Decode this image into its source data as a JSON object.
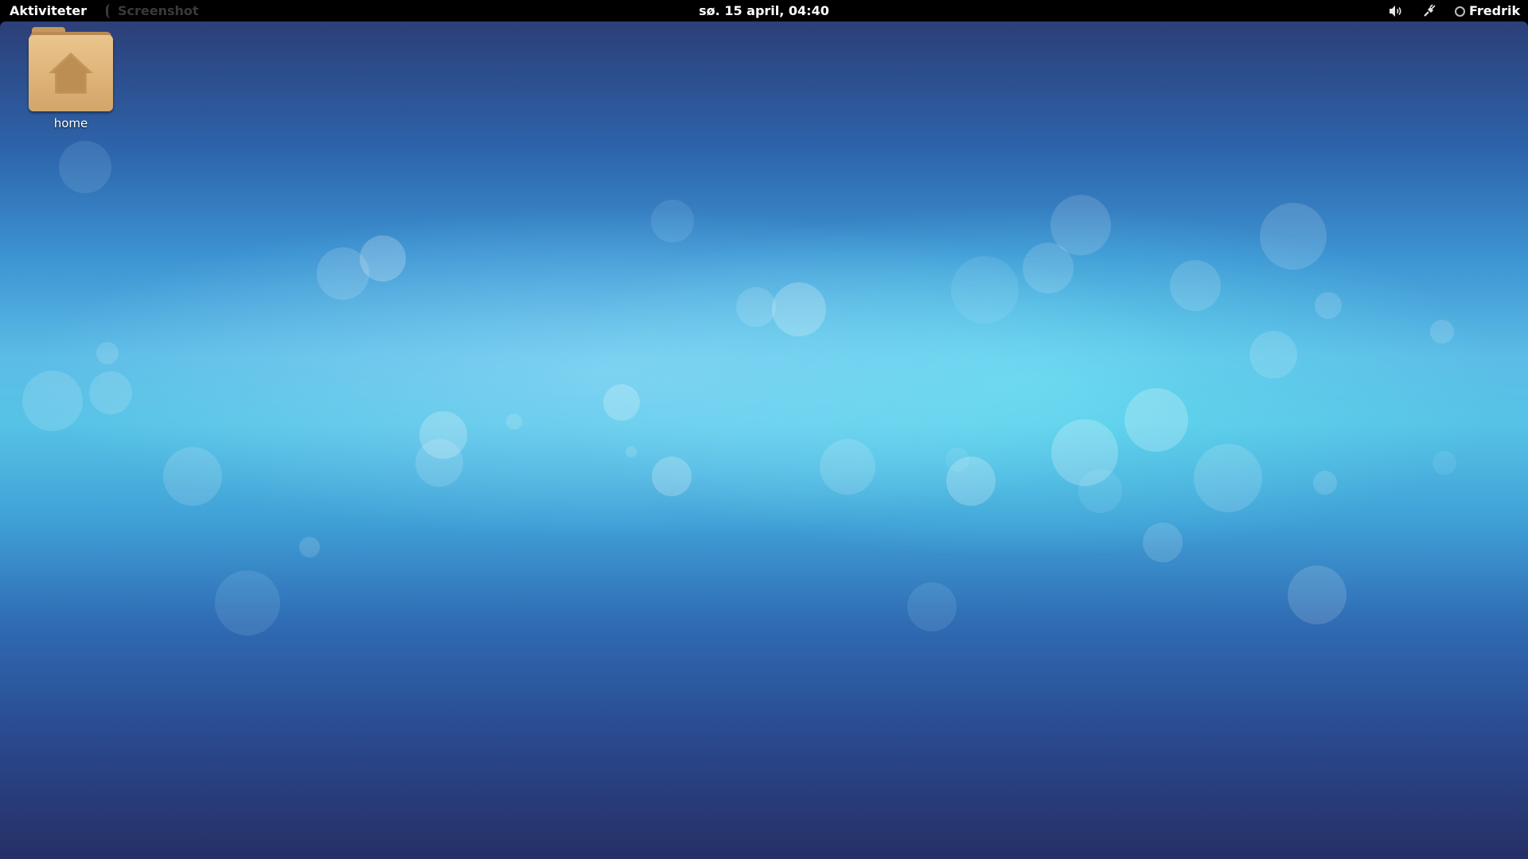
{
  "topbar": {
    "activities_label": "Aktiviteter",
    "app_menu_label": "Screenshot",
    "clock_text": "sø. 15 april, 04:40",
    "user_name": "Fredrik",
    "volume_icon": "volume-icon",
    "network_icon": "network-wired-icon"
  },
  "desktop": {
    "icons": [
      {
        "label": "home",
        "icon": "home-folder-icon"
      }
    ]
  },
  "colors": {
    "topbar_bg": "#000000",
    "wallpaper_primary": "#3c93d2",
    "wallpaper_highlight": "#5cc7e8",
    "folder": "#ddb277"
  }
}
